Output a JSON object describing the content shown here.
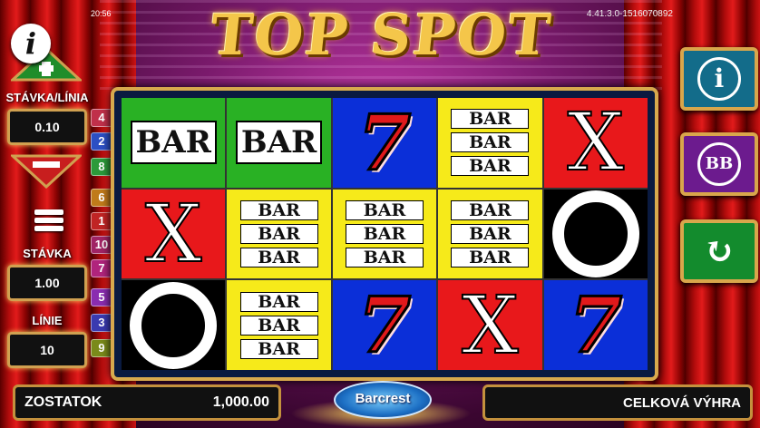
{
  "status": {
    "time": "20:56",
    "version": "4.41.3.0-1516070892"
  },
  "title": "TOP SPOT",
  "left_panel": {
    "info_glyph": "i",
    "stake_per_line_label": "STÁVKA/LÍNIA",
    "stake_per_line_value": "0.10",
    "stake_label": "STÁVKA",
    "stake_value": "1.00",
    "lines_label": "LÍNIE",
    "lines_value": "10"
  },
  "paylines": [
    {
      "n": "4",
      "color": "#c0304a"
    },
    {
      "n": "2",
      "color": "#2c4fc4"
    },
    {
      "n": "8",
      "color": "#2c9a3a"
    },
    {
      "n": "6",
      "color": "#c07a1a"
    },
    {
      "n": "1",
      "color": "#c02424"
    },
    {
      "n": "10",
      "color": "#a02464"
    },
    {
      "n": "7",
      "color": "#b0247c"
    },
    {
      "n": "5",
      "color": "#8a2cb0"
    },
    {
      "n": "3",
      "color": "#3a3ab0"
    },
    {
      "n": "9",
      "color": "#7a8a1a"
    }
  ],
  "reels": [
    [
      "BAR1",
      "BAR1",
      "SEVEN",
      "BAR3",
      "X"
    ],
    [
      "X",
      "BAR3",
      "BAR3",
      "BAR3",
      "O"
    ],
    [
      "O",
      "BAR3",
      "SEVEN",
      "X",
      "SEVEN"
    ]
  ],
  "symbol_text": {
    "bar": "BAR",
    "seven": "7",
    "x": "X"
  },
  "right_panel": {
    "info_glyph": "i",
    "bb_glyph": "BB",
    "spin_glyph": "↻"
  },
  "bottom": {
    "balance_label": "ZOSTATOK",
    "balance_value": "1,000.00",
    "logo": "Barcrest",
    "total_win_label": "CELKOVÁ VÝHRA"
  }
}
